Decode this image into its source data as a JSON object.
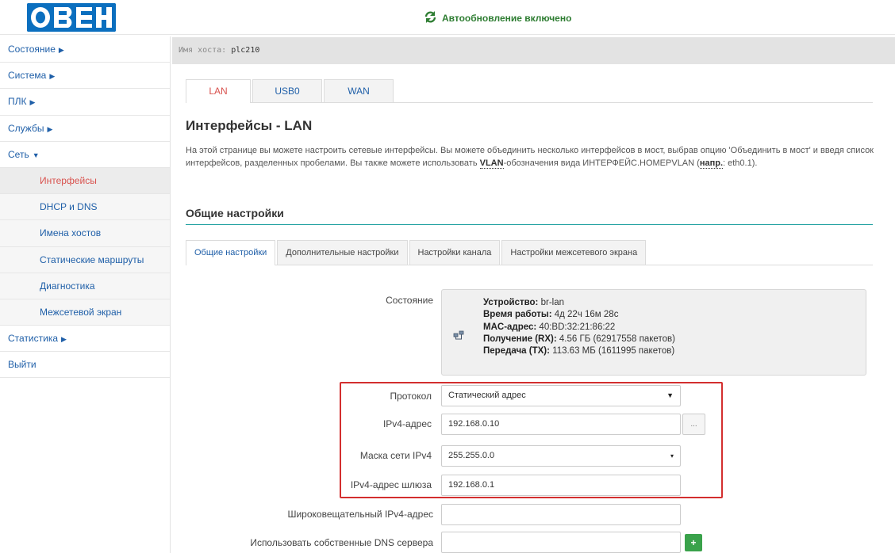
{
  "header": {
    "autoupdate_text": "Автообновление включено"
  },
  "colors": {
    "accent": "#1f5fa8",
    "active": "#d9534f",
    "success": "#3aa24b",
    "highlight": "#d32f2f"
  },
  "sidebar": {
    "items": [
      {
        "label": "Состояние",
        "caret": "▶"
      },
      {
        "label": "Система",
        "caret": "▶"
      },
      {
        "label": "ПЛК",
        "caret": "▶"
      },
      {
        "label": "Службы",
        "caret": "▶"
      },
      {
        "label": "Сеть",
        "caret": "▼"
      }
    ],
    "subitems": [
      {
        "label": "Интерфейсы"
      },
      {
        "label": "DHCP и DNS"
      },
      {
        "label": "Имена хостов"
      },
      {
        "label": "Статические маршруты"
      },
      {
        "label": "Диагностика"
      },
      {
        "label": "Межсетевой экран"
      }
    ],
    "bottom_items": [
      {
        "label": "Статистика",
        "caret": "▶"
      },
      {
        "label": "Выйти",
        "caret": ""
      }
    ]
  },
  "hostbar": {
    "label": "Имя хоста:",
    "value": "plc210"
  },
  "tabs_top": [
    "LAN",
    "USB0",
    "WAN"
  ],
  "page": {
    "title": "Интерфейсы - LAN",
    "desc_1": "На этой странице вы можете настроить сетевые интерфейсы. Вы можете объединить несколько интерфейсов в мост, выбрав опцию 'Объединить в мост' и введя список интерфейсов, разделенных пробелами. Вы также можете использовать ",
    "desc_vlan": "VLAN",
    "desc_2": "-обозначения вида ИНТЕРФЕЙС.НОМЕРVLAN (",
    "desc_abbr": "напр.",
    "desc_3": ": eth0.1).",
    "section_title": "Общие настройки"
  },
  "tabs_sub": [
    "Общие настройки",
    "Дополнительные настройки",
    "Настройки канала",
    "Настройки межсетевого экрана"
  ],
  "status": {
    "label": "Состояние",
    "device_label": "Устройство:",
    "device_value": "br-lan",
    "uptime_label": "Время работы:",
    "uptime_value": "4д 22ч 16м 28с",
    "mac_label": "MAC-адрес:",
    "mac_value": "40:BD:32:21:86:22",
    "rx_label": "Получение (RX):",
    "rx_value": "4.56 ГБ (62917558 пакетов)",
    "tx_label": "Передача (TX):",
    "tx_value": "113.63 МБ (1611995 пакетов)"
  },
  "form": {
    "protocol_label": "Протокол",
    "protocol_value": "Статический адрес",
    "ipv4_label": "IPv4-адрес",
    "ipv4_value": "192.168.0.10",
    "ipv4_btn": "...",
    "mask_label": "Маска сети IPv4",
    "mask_value": "255.255.0.0",
    "gateway_label": "IPv4-адрес шлюза",
    "gateway_value": "192.168.0.1",
    "broadcast_label": "Широковещательный IPv4-адрес",
    "broadcast_value": "",
    "dns_label": "Использовать собственные DNS сервера",
    "dns_value": "",
    "dns_add": "+"
  }
}
